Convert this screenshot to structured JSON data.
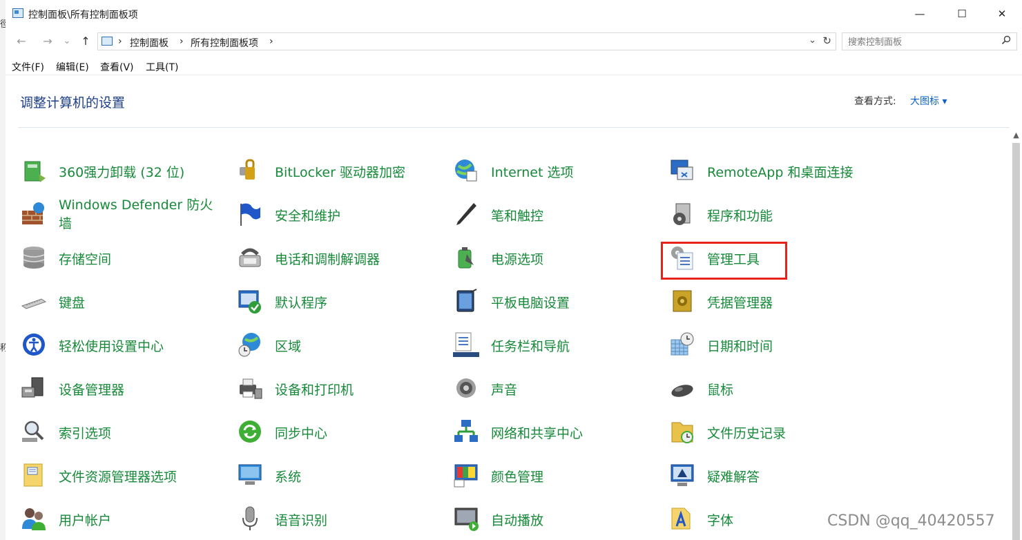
{
  "window": {
    "title": "控制面板\\所有控制面板项",
    "minimize_glyph": "—",
    "maximize_glyph": "☐",
    "close_glyph": "✕"
  },
  "edge": {
    "glyph_top": "徑",
    "glyph_mid": "称"
  },
  "nav": {
    "back": "←",
    "forward": "→",
    "recent": "⌄",
    "up": "↑"
  },
  "address": {
    "segments": [
      "控制面板",
      "所有控制面板项"
    ],
    "separator": "›",
    "dropdown_glyph": "⌄",
    "refresh_glyph": "↻"
  },
  "search": {
    "placeholder": "搜索控制面板",
    "icon": "search-icon"
  },
  "menu": [
    "文件(F)",
    "编辑(E)",
    "查看(V)",
    "工具(T)"
  ],
  "content": {
    "title": "调整计算机的设置",
    "view_by_label": "查看方式:",
    "view_by_value": "大图标 ▾"
  },
  "items": [
    {
      "label": "360强力卸载 (32 位)",
      "icon": "uninstaller-icon"
    },
    {
      "label": "BitLocker 驱动器加密",
      "icon": "bitlocker-icon"
    },
    {
      "label": "Internet 选项",
      "icon": "internet-options-icon"
    },
    {
      "label": "RemoteApp 和桌面连接",
      "icon": "remoteapp-icon"
    },
    {
      "label": "Windows Defender 防火墙",
      "icon": "firewall-icon"
    },
    {
      "label": "安全和维护",
      "icon": "security-flag-icon"
    },
    {
      "label": "笔和触控",
      "icon": "pen-icon"
    },
    {
      "label": "程序和功能",
      "icon": "programs-icon"
    },
    {
      "label": "存储空间",
      "icon": "storage-icon"
    },
    {
      "label": "电话和调制解调器",
      "icon": "phone-modem-icon"
    },
    {
      "label": "电源选项",
      "icon": "power-icon"
    },
    {
      "label": "管理工具",
      "icon": "admin-tools-icon"
    },
    {
      "label": "键盘",
      "icon": "keyboard-icon"
    },
    {
      "label": "默认程序",
      "icon": "default-programs-icon"
    },
    {
      "label": "平板电脑设置",
      "icon": "tablet-icon"
    },
    {
      "label": "凭据管理器",
      "icon": "credential-vault-icon"
    },
    {
      "label": "轻松使用设置中心",
      "icon": "ease-of-access-icon"
    },
    {
      "label": "区域",
      "icon": "region-globe-icon"
    },
    {
      "label": "任务栏和导航",
      "icon": "taskbar-icon"
    },
    {
      "label": "日期和时间",
      "icon": "datetime-icon"
    },
    {
      "label": "设备管理器",
      "icon": "device-manager-icon"
    },
    {
      "label": "设备和打印机",
      "icon": "printer-icon"
    },
    {
      "label": "声音",
      "icon": "speaker-icon"
    },
    {
      "label": "鼠标",
      "icon": "mouse-icon"
    },
    {
      "label": "索引选项",
      "icon": "indexing-icon"
    },
    {
      "label": "同步中心",
      "icon": "sync-icon"
    },
    {
      "label": "网络和共享中心",
      "icon": "network-icon"
    },
    {
      "label": "文件历史记录",
      "icon": "file-history-icon"
    },
    {
      "label": "文件资源管理器选项",
      "icon": "folder-options-icon"
    },
    {
      "label": "系统",
      "icon": "system-monitor-icon"
    },
    {
      "label": "颜色管理",
      "icon": "color-management-icon"
    },
    {
      "label": "疑难解答",
      "icon": "troubleshooting-icon"
    },
    {
      "label": "用户帐户",
      "icon": "user-accounts-icon"
    },
    {
      "label": "语音识别",
      "icon": "microphone-icon"
    },
    {
      "label": "自动播放",
      "icon": "autoplay-icon"
    },
    {
      "label": "字体",
      "icon": "fonts-icon"
    }
  ],
  "highlighted_item": "管理工具",
  "colors": {
    "link_green": "#178a3a",
    "title_blue": "#1e3f8a",
    "accent_blue": "#0b62c4",
    "highlight_red": "#e8221b"
  },
  "watermark": "CSDN @qq_40420557"
}
